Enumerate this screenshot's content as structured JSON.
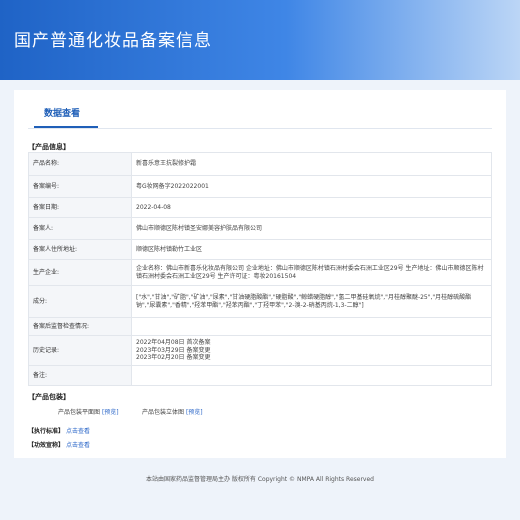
{
  "header": {
    "title": "国产普通化妆品备案信息"
  },
  "tabs": [
    {
      "label": "数据查看"
    }
  ],
  "product_info": {
    "section_title": "【产品信息】",
    "rows": [
      {
        "label": "产品名称:",
        "value": "新喜乐意王抗裂修护霜"
      },
      {
        "label": "备案编号:",
        "value": "粤G妆网备字2022022001"
      },
      {
        "label": "备案日期:",
        "value": "2022-04-08"
      },
      {
        "label": "备案人:",
        "value": "佛山市顺德区陈村镇圣安娜美容护肤品有限公司"
      },
      {
        "label": "备案人住所地址:",
        "value": "顺德区陈村镇勒竹工业区"
      },
      {
        "label": "生产企业:",
        "value": "企业名称：佛山市新喜乐化妆品有限公司 企业地址：佛山市顺德区陈村镇石洲村委会石洲工业区29号 生产地址：佛山市顺德区陈村镇石洲村委会石洲工业区29号 生产许可证：粤妆20161504"
      },
      {
        "label": "成分:",
        "value": "[\"水\",\"甘油\",\"矿脂\",\"矿油\",\"尿素\",\"甘油硬脂酸酯\",\"硬脂酸\",\"鲸蜡硬脂醇\",\"氢二甲基硅氧烷\",\"月桂醇聚醚-25\",\"月桂醇硫酸酯钠\",\"尿囊素\",\"香精\",\"羟苯甲酯\",\"羟苯丙酯\",\"丁羟甲苯\",\"2-溴-2-硝基丙烷-1,3-二醇\"]"
      },
      {
        "label": "备案后监督检查情况:",
        "value": ""
      },
      {
        "label": "历史记录:",
        "lines": [
          "2022年04月08日 首次备案",
          "2023年03月29日 备案变更",
          "2023年02月20日 备案变更"
        ]
      },
      {
        "label": "备注:",
        "value": ""
      }
    ]
  },
  "packaging": {
    "section_title": "【产品包装】",
    "items": [
      {
        "label": "产品包装平面图",
        "link": "[预览]"
      },
      {
        "label": "产品包装立体图",
        "link": "[预览]"
      }
    ]
  },
  "standard": {
    "section_title": "【执行标准】",
    "link": "点击查看"
  },
  "efficacy": {
    "section_title": "【功效宣称】",
    "link": "点击查看"
  },
  "footer": {
    "text": "本站由国家药品监督管理局主办 版权所有 Copyright © NMPA All Rights Reserved"
  }
}
